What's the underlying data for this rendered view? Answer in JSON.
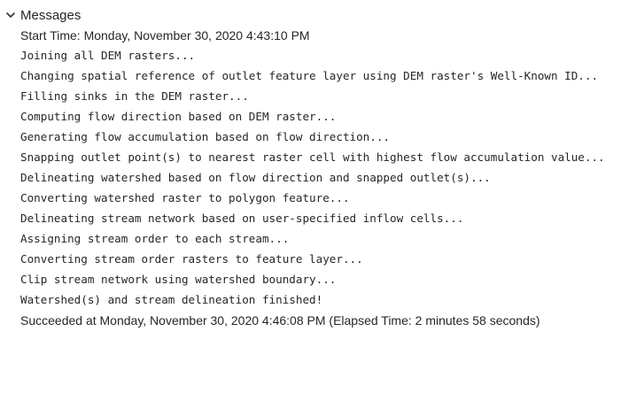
{
  "header": {
    "title": "Messages",
    "icon": "chevron-down-icon"
  },
  "messages": [
    {
      "text": "Start Time: Monday, November 30, 2020 4:43:10 PM",
      "style": "sans"
    },
    {
      "text": "Joining all DEM rasters...",
      "style": "mono"
    },
    {
      "text": "Changing spatial reference of outlet feature layer using DEM raster's Well-Known ID...",
      "style": "mono"
    },
    {
      "text": "Filling sinks in the DEM raster...",
      "style": "mono"
    },
    {
      "text": "Computing flow direction based on DEM raster...",
      "style": "mono"
    },
    {
      "text": "Generating flow accumulation based on flow direction...",
      "style": "mono"
    },
    {
      "text": "Snapping outlet point(s) to nearest raster cell with highest flow accumulation value...",
      "style": "mono"
    },
    {
      "text": "Delineating watershed based on flow direction and snapped outlet(s)...",
      "style": "mono"
    },
    {
      "text": "Converting watershed raster to polygon feature...",
      "style": "mono"
    },
    {
      "text": "Delineating stream network based on user-specified inflow cells...",
      "style": "mono"
    },
    {
      "text": "Assigning stream order to each stream...",
      "style": "mono"
    },
    {
      "text": "Converting stream order rasters to feature layer...",
      "style": "mono"
    },
    {
      "text": "Clip stream network using watershed boundary...",
      "style": "mono"
    },
    {
      "text": "Watershed(s) and stream delineation finished!",
      "style": "mono"
    },
    {
      "text": "Succeeded at Monday, November 30, 2020 4:46:08 PM (Elapsed Time: 2 minutes 58 seconds)",
      "style": "sans"
    }
  ]
}
